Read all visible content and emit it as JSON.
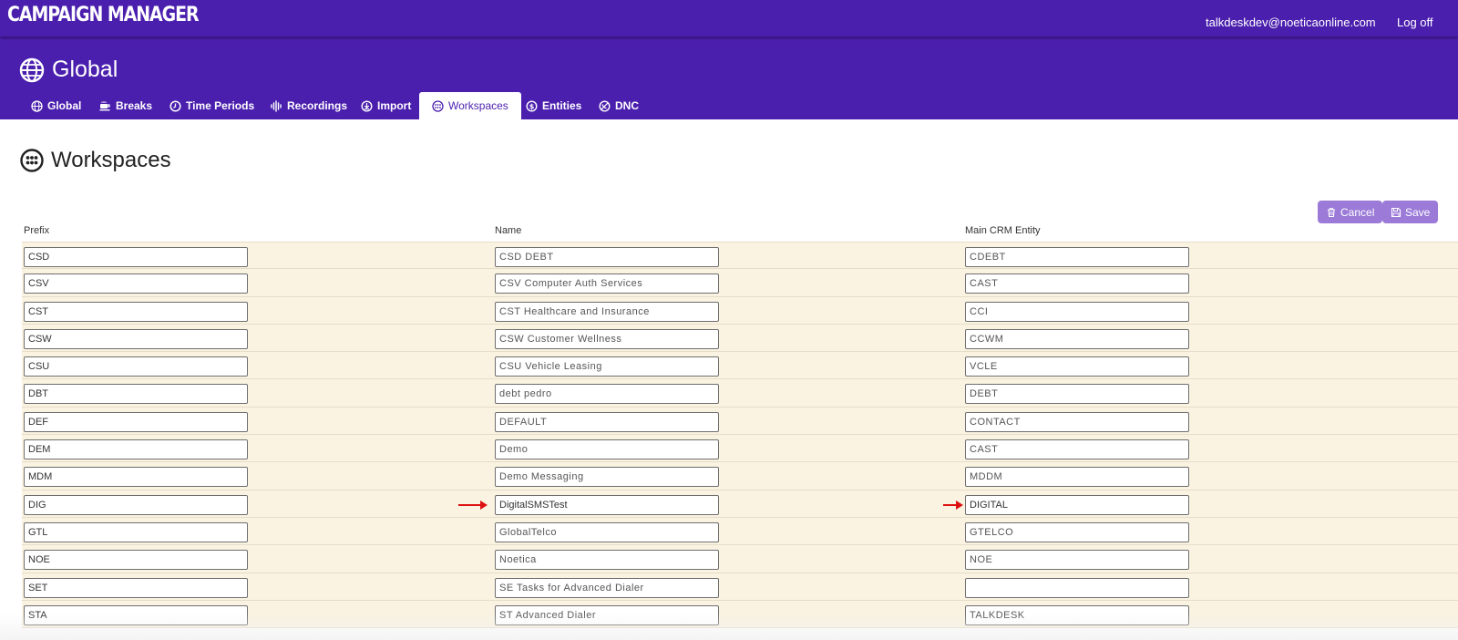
{
  "app": {
    "title": "CAMPAIGN MANAGER",
    "user_email": "talkdeskdev@noeticaonline.com",
    "logoff_label": "Log off"
  },
  "page": {
    "title": "Global",
    "icon": "globe-icon"
  },
  "tabs": [
    {
      "label": "Global",
      "icon": "globe-icon",
      "active": false
    },
    {
      "label": "Breaks",
      "icon": "coffee-icon",
      "active": false
    },
    {
      "label": "Time Periods",
      "icon": "clock-icon",
      "active": false
    },
    {
      "label": "Recordings",
      "icon": "waveform-icon",
      "active": false
    },
    {
      "label": "Import",
      "icon": "import-icon",
      "active": true
    },
    {
      "label": "Workspaces",
      "icon": "workspaces-icon",
      "active": true
    },
    {
      "label": "Entities",
      "icon": "entities-icon",
      "active": false
    },
    {
      "label": "DNC",
      "icon": "dnc-icon",
      "active": false
    }
  ],
  "section": {
    "title": "Workspaces",
    "icon": "workspaces-icon"
  },
  "actions": {
    "cancel_label": "Cancel",
    "save_label": "Save"
  },
  "table": {
    "columns": [
      "Prefix",
      "Name",
      "Main CRM Entity"
    ],
    "rows": [
      {
        "prefix": "CSD",
        "name": "CSD DEBT",
        "entity": "CDEBT"
      },
      {
        "prefix": "CSV",
        "name": "CSV Computer Auth Services",
        "entity": "CAST"
      },
      {
        "prefix": "CST",
        "name": "CST Healthcare and Insurance",
        "entity": "CCI"
      },
      {
        "prefix": "CSW",
        "name": "CSW Customer Wellness",
        "entity": "CCWM"
      },
      {
        "prefix": "CSU",
        "name": "CSU Vehicle Leasing",
        "entity": "VCLE"
      },
      {
        "prefix": "DBT",
        "name": "debt pedro",
        "entity": "DEBT"
      },
      {
        "prefix": "DEF",
        "name": "DEFAULT",
        "entity": "CONTACT"
      },
      {
        "prefix": "DEM",
        "name": "Demo",
        "entity": "CAST"
      },
      {
        "prefix": "MDM",
        "name": "Demo Messaging",
        "entity": "MDDM"
      },
      {
        "prefix": "DIG",
        "name": "DigitalSMSTest",
        "entity": "DIGITAL"
      },
      {
        "prefix": "GTL",
        "name": "GlobalTelco",
        "entity": "GTELCO"
      },
      {
        "prefix": "NOE",
        "name": "Noetica",
        "entity": "NOE"
      },
      {
        "prefix": "SET",
        "name": "SE Tasks for Advanced Dialer",
        "entity": ""
      },
      {
        "prefix": "STA",
        "name": "ST Advanced Dialer",
        "entity": "TALKDESK"
      }
    ]
  },
  "colors": {
    "brand": "#4b1fae",
    "button": "#9b7ad8",
    "row_background": "#faf3e2",
    "arrow": "#dd1111"
  }
}
